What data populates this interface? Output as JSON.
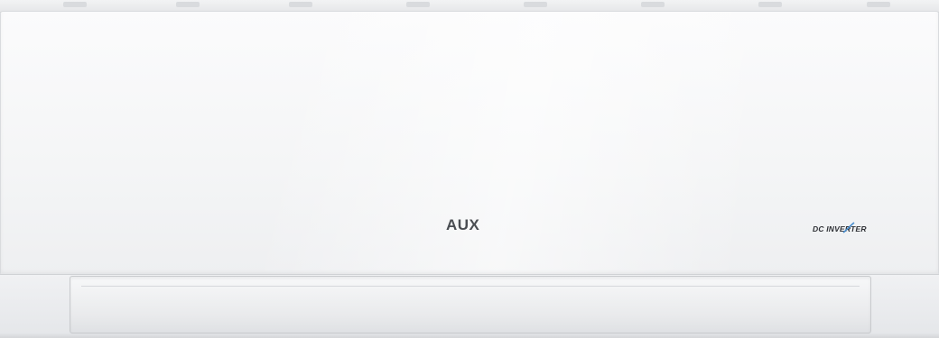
{
  "product": {
    "brand_logo": "AUX",
    "inverter_logo": "DC INVERTER"
  }
}
